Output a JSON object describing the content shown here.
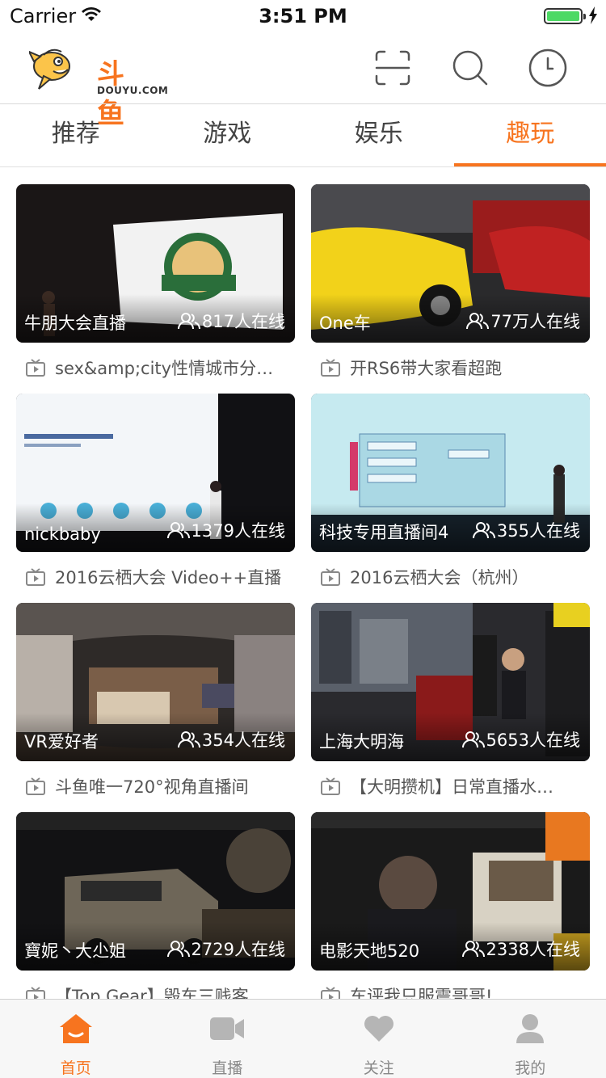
{
  "status_bar": {
    "carrier": "Carrier",
    "time": "3:51 PM",
    "battery_level": 1.0
  },
  "header": {
    "logo_text": "斗鱼",
    "logo_sub": "DOUYU.COM",
    "icons": [
      "scan-icon",
      "search-icon",
      "history-icon"
    ]
  },
  "tabs": [
    {
      "label": "推荐",
      "active": false
    },
    {
      "label": "游戏",
      "active": false
    },
    {
      "label": "娱乐",
      "active": false
    },
    {
      "label": "趣玩",
      "active": true
    }
  ],
  "rooms": [
    {
      "anchor": "牛朋大会直播",
      "online": "817人在线",
      "title": "sex&amp;city性情城市分…"
    },
    {
      "anchor": "One车",
      "online": "77万人在线",
      "title": "开RS6带大家看超跑"
    },
    {
      "anchor": "nickbaby",
      "online": "1379人在线",
      "title": "2016云栖大会 Video++直播"
    },
    {
      "anchor": "科技专用直播间4",
      "online": "355人在线",
      "title": "2016云栖大会（杭州）"
    },
    {
      "anchor": "VR爱好者",
      "online": "354人在线",
      "title": "斗鱼唯一720°视角直播间"
    },
    {
      "anchor": "上海大明海",
      "online": "5653人在线",
      "title": "【大明攒机】日常直播水…"
    },
    {
      "anchor": "寶妮丶大尐姐",
      "online": "2729人在线",
      "title": "【Top Gear】毁车三贱客…"
    },
    {
      "anchor": "电影天地520",
      "online": "2338人在线",
      "title": "车评我只服震哥哥!"
    }
  ],
  "thumb_colors": [
    {
      "a": "#2a2424",
      "b": "#4a3a30",
      "screen": "#f4f4f4"
    },
    {
      "a": "#2c2c2c",
      "b": "#b02020",
      "accent": "#f2d21a"
    },
    {
      "a": "#1e1e22",
      "b": "#d8e4ec",
      "screen": "#eef3f7"
    },
    {
      "a": "#1c2a36",
      "b": "#bfe6ef",
      "screen": "#c8ecf2"
    },
    {
      "a": "#3a3430",
      "b": "#6c5a48",
      "screen": "#8a7a66"
    },
    {
      "a": "#2a2a2c",
      "b": "#5a5e66",
      "screen": "#9aa0a8"
    },
    {
      "a": "#141416",
      "b": "#5a5040",
      "screen": "#7c7060"
    },
    {
      "a": "#1a1a1a",
      "b": "#3a3a3a",
      "screen": "#c8c0b0"
    }
  ],
  "bottom_nav": [
    {
      "label": "首页",
      "icon": "home-icon",
      "active": true
    },
    {
      "label": "直播",
      "icon": "video-camera-icon",
      "active": false
    },
    {
      "label": "关注",
      "icon": "heart-icon",
      "active": false
    },
    {
      "label": "我的",
      "icon": "user-icon",
      "active": false
    }
  ],
  "colors": {
    "accent": "#f7741f",
    "inactive": "#b5b5b5"
  }
}
